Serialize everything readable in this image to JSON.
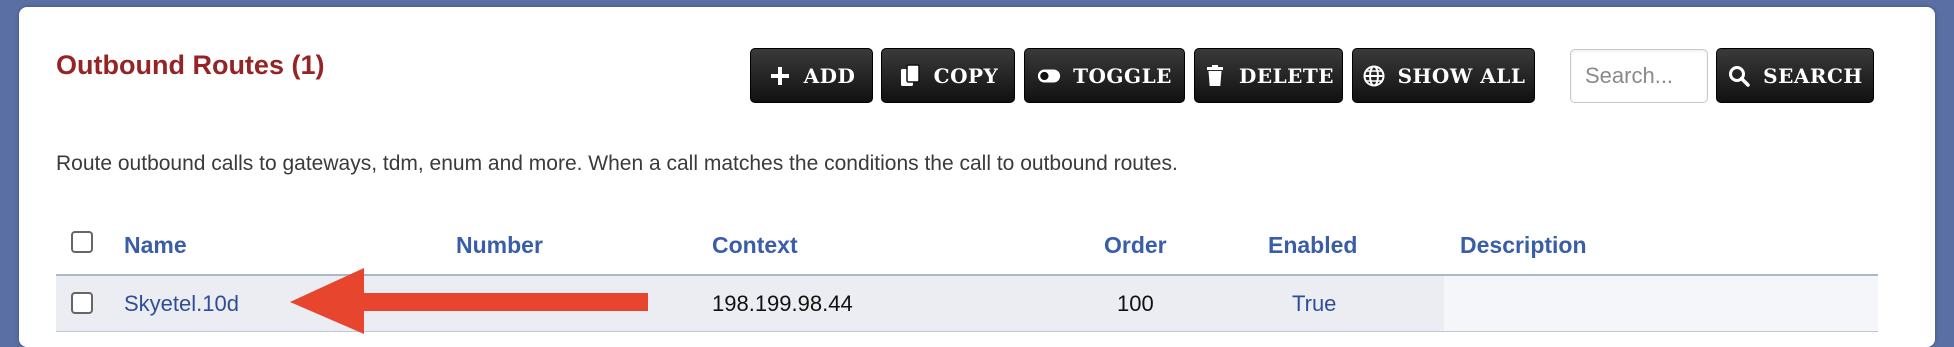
{
  "page": {
    "title": "Outbound Routes (1)",
    "description": "Route outbound calls to gateways, tdm, enum and more. When a call matches the conditions the call to outbound routes."
  },
  "toolbar": {
    "add_label": "ADD",
    "copy_label": "COPY",
    "toggle_label": "TOGGLE",
    "delete_label": "DELETE",
    "show_all_label": "SHOW ALL",
    "search_label": "SEARCH"
  },
  "search": {
    "placeholder": "Search...",
    "value": ""
  },
  "table": {
    "columns": [
      "Name",
      "Number",
      "Context",
      "Order",
      "Enabled",
      "Description"
    ],
    "rows": [
      {
        "name": "Skyetel.10d",
        "number": "",
        "context": "198.199.98.44",
        "order": "100",
        "enabled": "True",
        "description": ""
      }
    ]
  },
  "colors": {
    "title": "#952424",
    "header": "#3a5da8",
    "button_bg": "#111111",
    "arrow": "#e8452f",
    "row_bg": "#ecedf2"
  },
  "icons": {
    "add": "plus-icon",
    "copy": "copy-icon",
    "toggle": "toggle-icon",
    "delete": "trash-icon",
    "show_all": "globe-icon",
    "search": "search-icon",
    "annotation": "red-arrow"
  }
}
